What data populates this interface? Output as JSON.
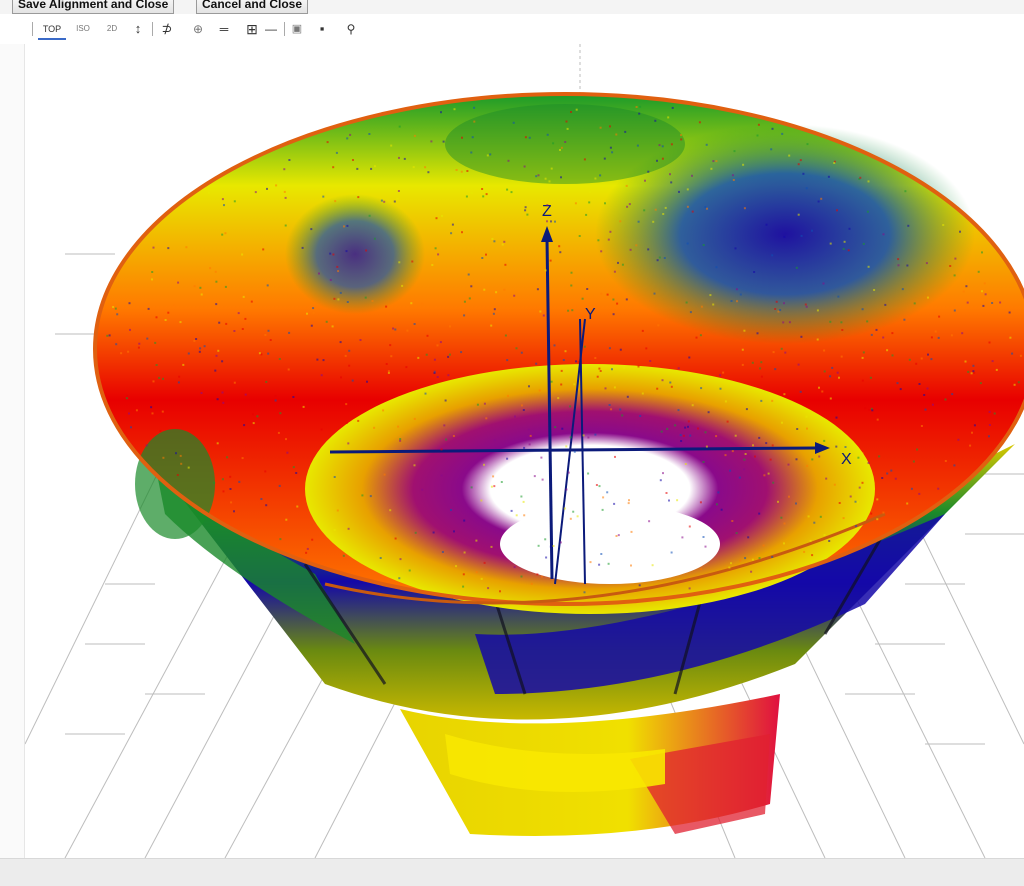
{
  "window": {
    "buttons": [
      {
        "label": "Save Alignment and Close"
      },
      {
        "label": "Cancel and Close"
      }
    ]
  },
  "toolbar": {
    "tools": [
      {
        "label": "TOP",
        "icon": "top-view-icon"
      },
      {
        "label": "ISO",
        "icon": "iso-view-icon"
      },
      {
        "label": "2D",
        "icon": "2d-view-icon"
      },
      {
        "label": "↕",
        "icon": "axis-arrows-icon"
      },
      {
        "label": "⊅",
        "icon": "section-tool-icon"
      },
      {
        "label": "⊕",
        "icon": "rotate-icon"
      },
      {
        "label": "═",
        "icon": "level-icon"
      },
      {
        "label": "⊞",
        "icon": "grid-icon"
      },
      {
        "label": "—",
        "icon": "line-tool-icon"
      },
      {
        "label": "▣",
        "icon": "box-tool-icon"
      },
      {
        "label": "▪",
        "icon": "camera-icon"
      },
      {
        "label": "⚲",
        "icon": "pin-icon"
      }
    ]
  },
  "viewport": {
    "axes": {
      "x": "X",
      "y": "Y",
      "z": "Z"
    },
    "colors": {
      "axis": "#0b1a7a",
      "deviation_scale": [
        "#1408a8",
        "#0d4fb6",
        "#1a9a2a",
        "#e8e800",
        "#ff7a00",
        "#e80000",
        "#8a0a8a"
      ],
      "grid": "#bdbdbd"
    }
  }
}
